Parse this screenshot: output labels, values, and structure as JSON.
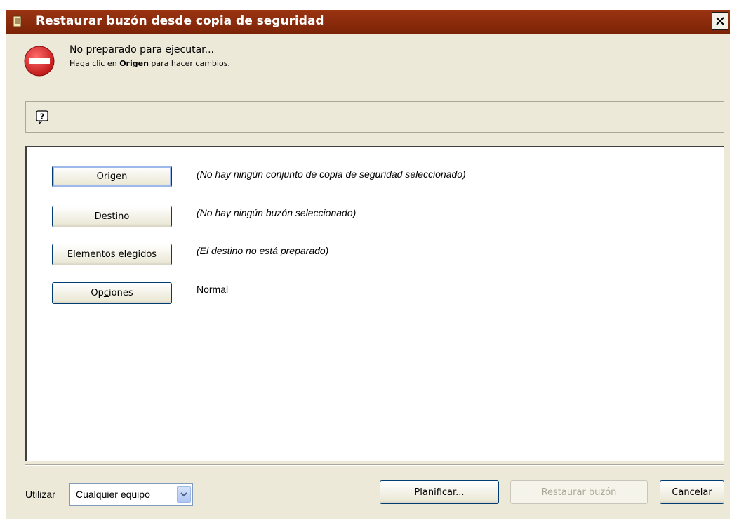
{
  "window": {
    "title": "Restaurar buzón desde copia de seguridad"
  },
  "status": {
    "main": "No preparado para ejecutar...",
    "hint_prefix": "Haga clic en ",
    "hint_bold": "Origen",
    "hint_suffix": " para hacer cambios."
  },
  "rows": [
    {
      "button_pre": "",
      "button_ul": "O",
      "button_post": "rigen",
      "description": "(No hay ningún conjunto de copia de seguridad seleccionado)"
    },
    {
      "button_pre": "D",
      "button_ul": "e",
      "button_post": "stino",
      "description": "(No hay ningún buzón seleccionado)"
    },
    {
      "button_pre": "Elementos ele",
      "button_ul": "g",
      "button_post": "idos",
      "description": "(El destino no está preparado)"
    },
    {
      "button_pre": "Op",
      "button_ul": "c",
      "button_post": "iones",
      "description": "Normal"
    }
  ],
  "footer": {
    "use_label": "Utilizar",
    "use_value": "Cualquier equipo",
    "schedule_pre": "P",
    "schedule_ul": "l",
    "schedule_post": "anificar...",
    "restore_pre": "Rest",
    "restore_ul": "a",
    "restore_post": "urar buzón",
    "cancel_label": "Cancelar"
  },
  "colors": {
    "titlebar": "#8b2a0f",
    "window_bg": "#ece9d8",
    "stop_icon": "#d42020"
  },
  "icons": [
    "document-icon",
    "close-icon",
    "stop-icon",
    "help-icon",
    "chevron-down-icon"
  ]
}
